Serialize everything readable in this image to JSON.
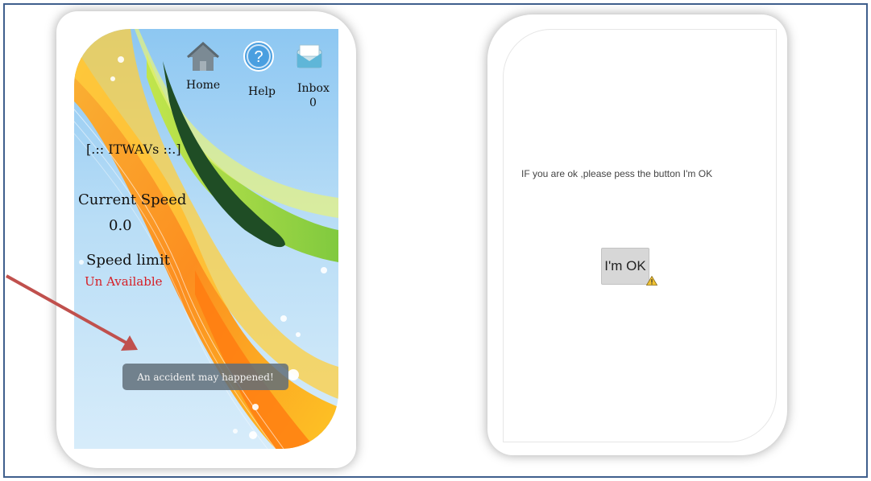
{
  "left_phone": {
    "nav": {
      "home_label": "Home",
      "help_label": "Help",
      "inbox_label": "Inbox",
      "inbox_count": "0"
    },
    "app_title": "[.:: ITWAVs ::.]",
    "current_speed_label": "Current Speed",
    "current_speed_value": "0.0",
    "speed_limit_label": "Speed limit",
    "speed_limit_value": "Un Available",
    "toast_message": "An accident may happened!"
  },
  "right_phone": {
    "prompt_text": "IF you are ok ,please pess the button  I'm OK",
    "ok_button_label": "I'm OK"
  },
  "colors": {
    "frame_border": "#3f5f8d",
    "arrow": "#c0504d",
    "unavailable_text": "#d61f26"
  },
  "icons": [
    "home-icon",
    "help-icon",
    "inbox-icon",
    "warning-icon",
    "arrow-annotation"
  ]
}
